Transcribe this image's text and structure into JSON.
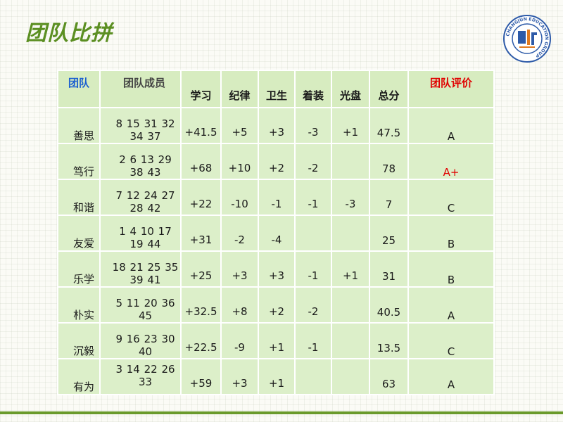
{
  "title": "团队比拼",
  "headers": {
    "team": "团队",
    "members": "团队成员",
    "study": "学习",
    "discipline": "纪律",
    "hygiene": "卫生",
    "dress": "着装",
    "clean_plate": "光盘",
    "total": "总分",
    "evaluation": "团队评价"
  },
  "rows": [
    {
      "team": "善思",
      "members": "8 15 31 32 34 37",
      "study": "+41.5",
      "discipline": "+5",
      "hygiene": "+3",
      "dress": "-3",
      "clean_plate": "+1",
      "total": "47.5",
      "evaluation": "A"
    },
    {
      "team": "笃行",
      "members": "2 6 13 29 38 43",
      "study": "+68",
      "discipline": "+10",
      "hygiene": "+2",
      "dress": "-2",
      "clean_plate": "",
      "total": "78",
      "evaluation": "A+"
    },
    {
      "team": "和谐",
      "members": "7 12 24 27 28 42",
      "study": "+22",
      "discipline": "-10",
      "hygiene": "-1",
      "dress": "-1",
      "clean_plate": "-3",
      "total": "7",
      "evaluation": "C"
    },
    {
      "team": "友爱",
      "members": "1 4 10 17 19 44",
      "study": "+31",
      "discipline": "-2",
      "hygiene": "-4",
      "dress": "",
      "clean_plate": "",
      "total": "25",
      "evaluation": "B"
    },
    {
      "team": "乐学",
      "members": "18 21 25 35 39 41",
      "study": "+25",
      "discipline": "+3",
      "hygiene": "+3",
      "dress": "-1",
      "clean_plate": "+1",
      "total": "31",
      "evaluation": "B"
    },
    {
      "team": "朴实",
      "members": "5 11 20 36 45",
      "study": "+32.5",
      "discipline": "+8",
      "hygiene": "+2",
      "dress": "-2",
      "clean_plate": "",
      "total": "40.5",
      "evaluation": "A"
    },
    {
      "team": "沉毅",
      "members": "9 16 23 30 40",
      "study": "+22.5",
      "discipline": "-9",
      "hygiene": "+1",
      "dress": "-1",
      "clean_plate": "",
      "total": "13.5",
      "evaluation": "C"
    },
    {
      "team": "有为",
      "members": "3 14 22 26 33",
      "study": "+59",
      "discipline": "+3",
      "hygiene": "+1",
      "dress": "",
      "clean_plate": "",
      "total": "63",
      "evaluation": "A"
    }
  ],
  "colors": {
    "title": "#5b8f22",
    "header_team": "#1b5fd0",
    "header_eval": "#e00000",
    "total": "#23a04a",
    "eval_default": "#3a5a8c",
    "eval_highlight": "#e00000",
    "cell_bg": "#dcefc9",
    "rule": "#6a9a2b"
  },
  "logo": {
    "icon": "school-emblem-icon",
    "ring_text": "CHANGJUN EDUCATION GROUP"
  }
}
